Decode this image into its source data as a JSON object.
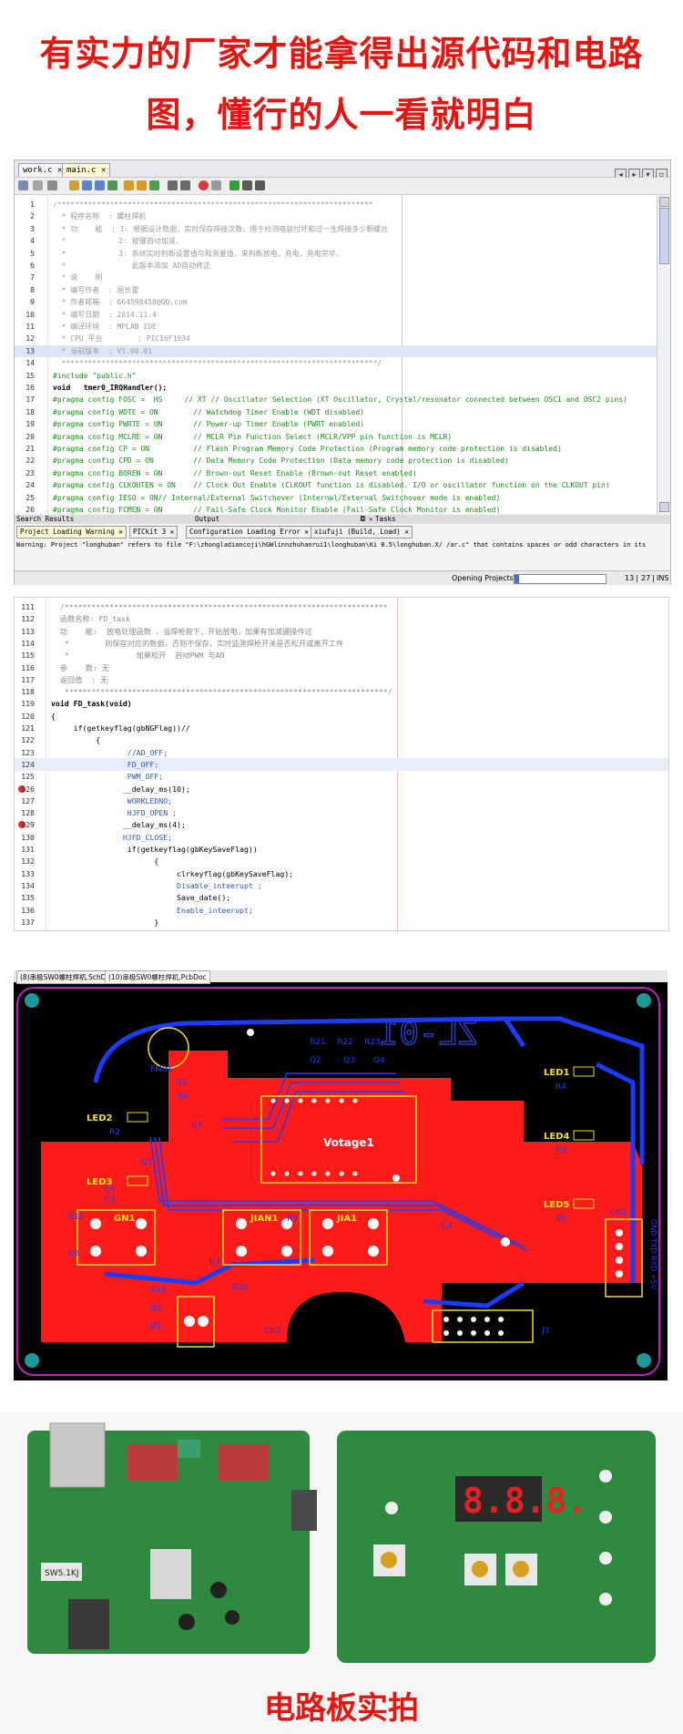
{
  "headline": {
    "line1": "有实力的厂家才能拿得出源代码和电路",
    "line2": "图，懂行的人一看就明白"
  },
  "ide1": {
    "tabs": [
      "work.c",
      "main.c"
    ],
    "code_lines": [
      {
        "n": "1",
        "t": "/************************************************************************"
      },
      {
        "n": "2",
        "t": "  * 程序名称  : 螺柱焊机"
      },
      {
        "n": "3",
        "t": "  * 功    能  : 1: 根据设计数据，实时保存焊接次数，用于检测电容付坏和过一生焊接多少颗螺丝"
      },
      {
        "n": "4",
        "t": "  *            2: 按键自动加减，"
      },
      {
        "n": "5",
        "t": "  *            3: 系统实时判断设置值与和测量值，来判断放电，充电，充电完毕，"
      },
      {
        "n": "6",
        "t": "  *               此版本添加 AD自动修正"
      },
      {
        "n": "7",
        "t": "  * 说    明"
      },
      {
        "n": "8",
        "t": "  * 编写作者  : 屈长雷"
      },
      {
        "n": "9",
        "t": "  * 作者邮箱  : 664598458@QQ.com"
      },
      {
        "n": "10",
        "t": "  * 编写日期  : 2014.11.4"
      },
      {
        "n": "11",
        "t": "  * 编译环境  : MPLAB IDE"
      },
      {
        "n": "12",
        "t": "  * CPU 平台        : PIC16F1934"
      },
      {
        "n": "13",
        "t": "  * 当前版本  : V1.00.01"
      },
      {
        "n": "14",
        "t": "  ************************************************************************/"
      },
      {
        "n": "15",
        "t": "#include \"public.h\""
      },
      {
        "n": "16",
        "t": "void   tmer0_IRQHandler();"
      },
      {
        "n": "17",
        "t": "#pragma config FOSC =  HS     // XT // Oscillator Selection (XT Oscillator, Crystal/resonator connected between OSC1 and OSC2 pins)"
      },
      {
        "n": "18",
        "t": "#pragma config WDTE = ON        // Watchdog Timer Enable (WDT disabled)"
      },
      {
        "n": "19",
        "t": "#pragma config PWRTE = ON       // Power-up Timer Enable (PWRT enabled)"
      },
      {
        "n": "20",
        "t": "#pragma config MCLRE = ON       // MCLR Pin Function Select (MCLR/VPP pin function is MCLR)"
      },
      {
        "n": "21",
        "t": "#pragma config CP = ON          // Flash Program Memory Code Protection (Program memory code protection is disabled)"
      },
      {
        "n": "22",
        "t": "#pragma config CPD = ON         // Data Memory Code Protection (Data memory code protection is disabled)"
      },
      {
        "n": "23",
        "t": "#pragma config BOREN = ON       // Brown-out Reset Enable (Brown-out Reset enabled)"
      },
      {
        "n": "24",
        "t": "#pragma config CLKOUTEN = ON    // Clock Out Enable (CLKOUT function is disabled. I/O or oscillator function on the CLKOUT pin)"
      },
      {
        "n": "25",
        "t": "#pragma config IESO = ON// Internal/External Switchover (Internal/External Switchover mode is enabled)"
      },
      {
        "n": "26",
        "t": "#pragma config FCMEN = ON       // Fail-Safe Clock Monitor Enable (Fail-Safe Clock Monitor is enabled)"
      }
    ],
    "panel_tabs": [
      "Search Results",
      "Output",
      "Tasks"
    ],
    "output_tabs": [
      "Project Loading Warning",
      "PICkit 3",
      "Configuration Loading Error",
      "xiufuji (Build, Load)"
    ],
    "output_text": "Warning: Project \"longhuban\" refers to file \"F:\\zhongladiancoji\\hGWlinnzhuhanrui1\\longhuban\\Ki 0.5\\longhuban.X/ /ar.c\" that contains spaces or odd characters in its",
    "status_label": "Opening Projects",
    "status_progress": "5%",
    "status_line": "13",
    "status_col": "27",
    "status_mode": "INS"
  },
  "ide2": {
    "code_lines": [
      {
        "n": "111",
        "t": "  /************************************************************************"
      },
      {
        "n": "112",
        "t": "  函数名称: FD_task"
      },
      {
        "n": "113",
        "t": "  功    能:  放电处理函数 ，当焊枪按下，开始放电，加果有加减键操作过"
      },
      {
        "n": "114",
        "t": "   *        则保存对应的数据，否则不保存，实时监测焊枪开关是否松开或离开工件"
      },
      {
        "n": "115",
        "t": "   *               加果松开  启动PWM 与AD"
      },
      {
        "n": "116",
        "t": "  参    数: 无"
      },
      {
        "n": "117",
        "t": "  返回值  : 无"
      },
      {
        "n": "118",
        "t": "   ************************************************************************/"
      },
      {
        "n": "119",
        "t": "void FD_task(void)"
      },
      {
        "n": "120",
        "t": "{"
      },
      {
        "n": "121",
        "t": "     if(getkeyflag(gbNGFlag))//"
      },
      {
        "n": "122",
        "t": "          {"
      },
      {
        "n": "123",
        "t": "                 //AD_OFF;"
      },
      {
        "n": "124",
        "t": "                 FD_OFF;"
      },
      {
        "n": "125",
        "t": "                 PWM_OFF;"
      },
      {
        "n": "126",
        "t": "                __delay_ms(10);"
      },
      {
        "n": "127",
        "t": "                 WORKLEDNO;"
      },
      {
        "n": "128",
        "t": "                 HJFD_OPEN ;"
      },
      {
        "n": "129",
        "t": "                __delay_ms(4);"
      },
      {
        "n": "130",
        "t": "                HJFD_CLOSE;"
      },
      {
        "n": "131",
        "t": "                 if(getkeyflag(gbKeySaveFlag))"
      },
      {
        "n": "132",
        "t": "                       {"
      },
      {
        "n": "133",
        "t": "                            clrkeyflag(gbKeySaveFlag);"
      },
      {
        "n": "134",
        "t": "                            Disable_inteerupt ;"
      },
      {
        "n": "135",
        "t": "                            Save_date();"
      },
      {
        "n": "136",
        "t": "                            Enable_inteerupt;"
      },
      {
        "n": "137",
        "t": "                       }"
      }
    ]
  },
  "pcb": {
    "tabs": [
      "(8)串极SW0螺柱焊机.SchDoc",
      "(10)串极SW0螺柱焊机.PcbDoc"
    ],
    "board_title": "ZL-01",
    "labels": [
      "LED1",
      "LED2",
      "LED3",
      "LED4",
      "LED5",
      "R21",
      "R22",
      "R23",
      "Q2",
      "Q3",
      "Q4",
      "R4",
      "R3",
      "R5",
      "Q1",
      "Q1",
      "R6",
      "R7",
      "R2",
      "FM01",
      "Votage1",
      "GN1",
      "JIAN1",
      "JIA1",
      "R10",
      "C8",
      "C5",
      "C3",
      "R15",
      "R20",
      "D2",
      "D1",
      "CN1",
      "CN2",
      "J3",
      "R7",
      "R9",
      "C4",
      "GND TXD RXD +5V"
    ]
  },
  "photo": {
    "caption": "电路板实拍",
    "display_digits": "8.8.8.",
    "chip_label": "SW5.1KJ"
  },
  "colors": {
    "headline": "#e8140f",
    "pcb_top": "#ff1a1a",
    "pcb_bottom": "#1a3cff",
    "silk": "#f0e020",
    "board_green": "#2f8a40"
  }
}
